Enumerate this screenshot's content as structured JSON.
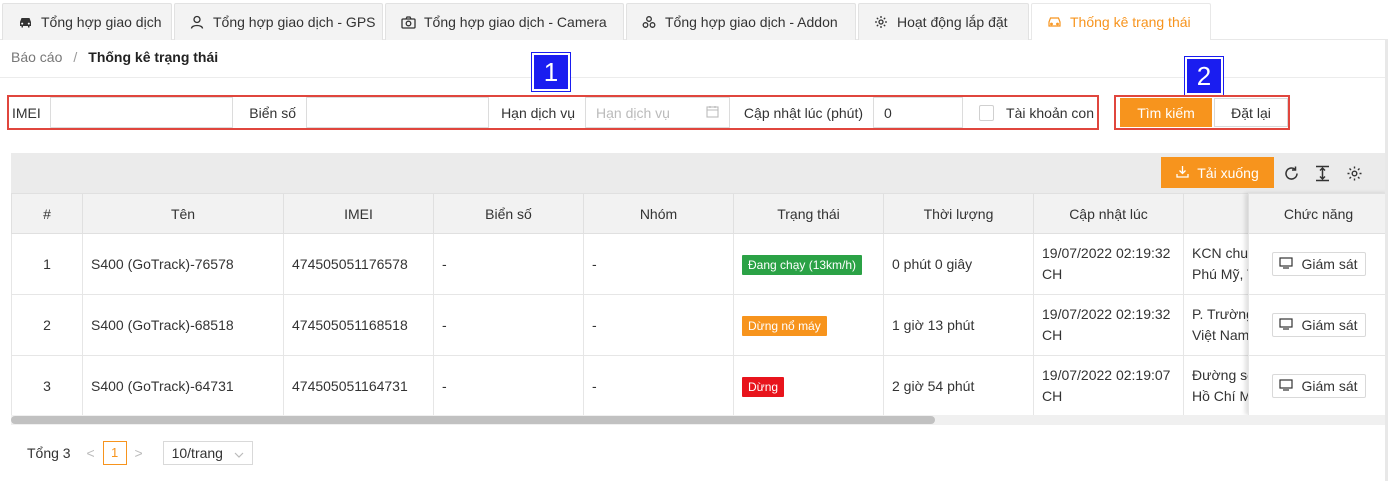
{
  "tabs": [
    {
      "label": "Tổng hợp giao dịch",
      "icon": "car-icon"
    },
    {
      "label": "Tổng hợp giao dịch - GPS",
      "icon": "user-icon"
    },
    {
      "label": "Tổng hợp giao dịch - Camera",
      "icon": "camera-icon"
    },
    {
      "label": "Tổng hợp giao dịch - Addon",
      "icon": "cluster-icon"
    },
    {
      "label": "Hoạt động lắp đặt",
      "icon": "gear-icon"
    },
    {
      "label": "Thống kê trạng thái",
      "icon": "car-icon",
      "active": true
    }
  ],
  "breadcrumb": {
    "root": "Báo cáo",
    "separator": "/",
    "current": "Thống kê trạng thái"
  },
  "filters": {
    "imei_label": "IMEI",
    "imei_value": "",
    "plate_label": "Biển số",
    "plate_value": "",
    "service_label": "Hạn dịch vụ",
    "service_placeholder": "Hạn dịch vụ",
    "update_label": "Cập nhật lúc (phút)",
    "update_value": "0",
    "subaccount_label": "Tài khoản con",
    "subaccount_checked": false
  },
  "annotations": {
    "badge1": "1",
    "badge2": "2"
  },
  "actions": {
    "search": "Tìm kiếm",
    "reset": "Đặt lại",
    "download": "Tải xuống"
  },
  "table": {
    "headers": [
      "#",
      "Tên",
      "IMEI",
      "Biển số",
      "Nhóm",
      "Trạng thái",
      "Thời lượng",
      "Cập nhật lúc",
      "",
      "Chức năng"
    ],
    "rows": [
      {
        "idx": "1",
        "name": "S400 (GoTrack)-76578",
        "imei": "474505051176578",
        "plate": "-",
        "group": "-",
        "status": "Đang chạy (13km/h)",
        "status_color": "#2ba246",
        "duration": "0 phút 0 giây",
        "updated_1": "19/07/2022 02:19:32",
        "updated_2": "CH",
        "addr_1": "KCN chuy",
        "addr_2": "Phú Mỹ, T",
        "action": "Giám sát"
      },
      {
        "idx": "2",
        "name": "S400 (GoTrack)-68518",
        "imei": "474505051168518",
        "plate": "-",
        "group": "-",
        "status": "Dừng nổ máy",
        "status_color": "#f7941d",
        "duration": "1 giờ 13 phút",
        "updated_1": "19/07/2022 02:19:32",
        "updated_2": "CH",
        "addr_1": "P. Trường",
        "addr_2": "Việt Nam",
        "action": "Giám sát"
      },
      {
        "idx": "3",
        "name": "S400 (GoTrack)-64731",
        "imei": "474505051164731",
        "plate": "-",
        "group": "-",
        "status": "Dừng",
        "status_color": "#e8141c",
        "duration": "2 giờ 54 phút",
        "updated_1": "19/07/2022 02:19:07",
        "updated_2": "CH",
        "addr_1": "Đường số",
        "addr_2": "Hồ Chí M",
        "action": "Giám sát"
      }
    ]
  },
  "pagination": {
    "total": "Tổng 3",
    "prev": "<",
    "page": "1",
    "next": ">",
    "page_size": "10/trang"
  },
  "colors": {
    "accent": "#f7941d",
    "highlight_border": "#e0463d",
    "badge": "#1a1df0"
  }
}
